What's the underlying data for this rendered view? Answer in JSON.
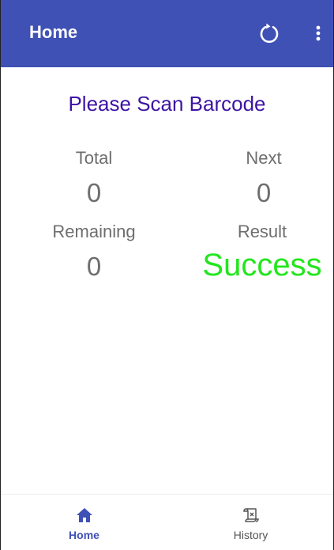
{
  "appbar": {
    "title": "Home",
    "actions": [
      {
        "icon": "refresh-icon"
      },
      {
        "icon": "more-vert-icon"
      }
    ]
  },
  "main": {
    "headline": "Please Scan Barcode",
    "stats": {
      "total": {
        "label": "Total",
        "value": "0"
      },
      "next": {
        "label": "Next",
        "value": "0"
      },
      "remaining": {
        "label": "Remaining",
        "value": "0"
      },
      "result": {
        "label": "Result",
        "value": "Success"
      }
    }
  },
  "bottom_nav": {
    "items": [
      {
        "label": "Home",
        "icon": "home-icon",
        "selected": true
      },
      {
        "label": "History",
        "icon": "history-scroll-icon",
        "selected": false
      }
    ]
  },
  "colors": {
    "primary": "#3f51b5",
    "headline": "#3d14a3",
    "success": "#22e61c",
    "muted_text": "#6e6e6e"
  }
}
